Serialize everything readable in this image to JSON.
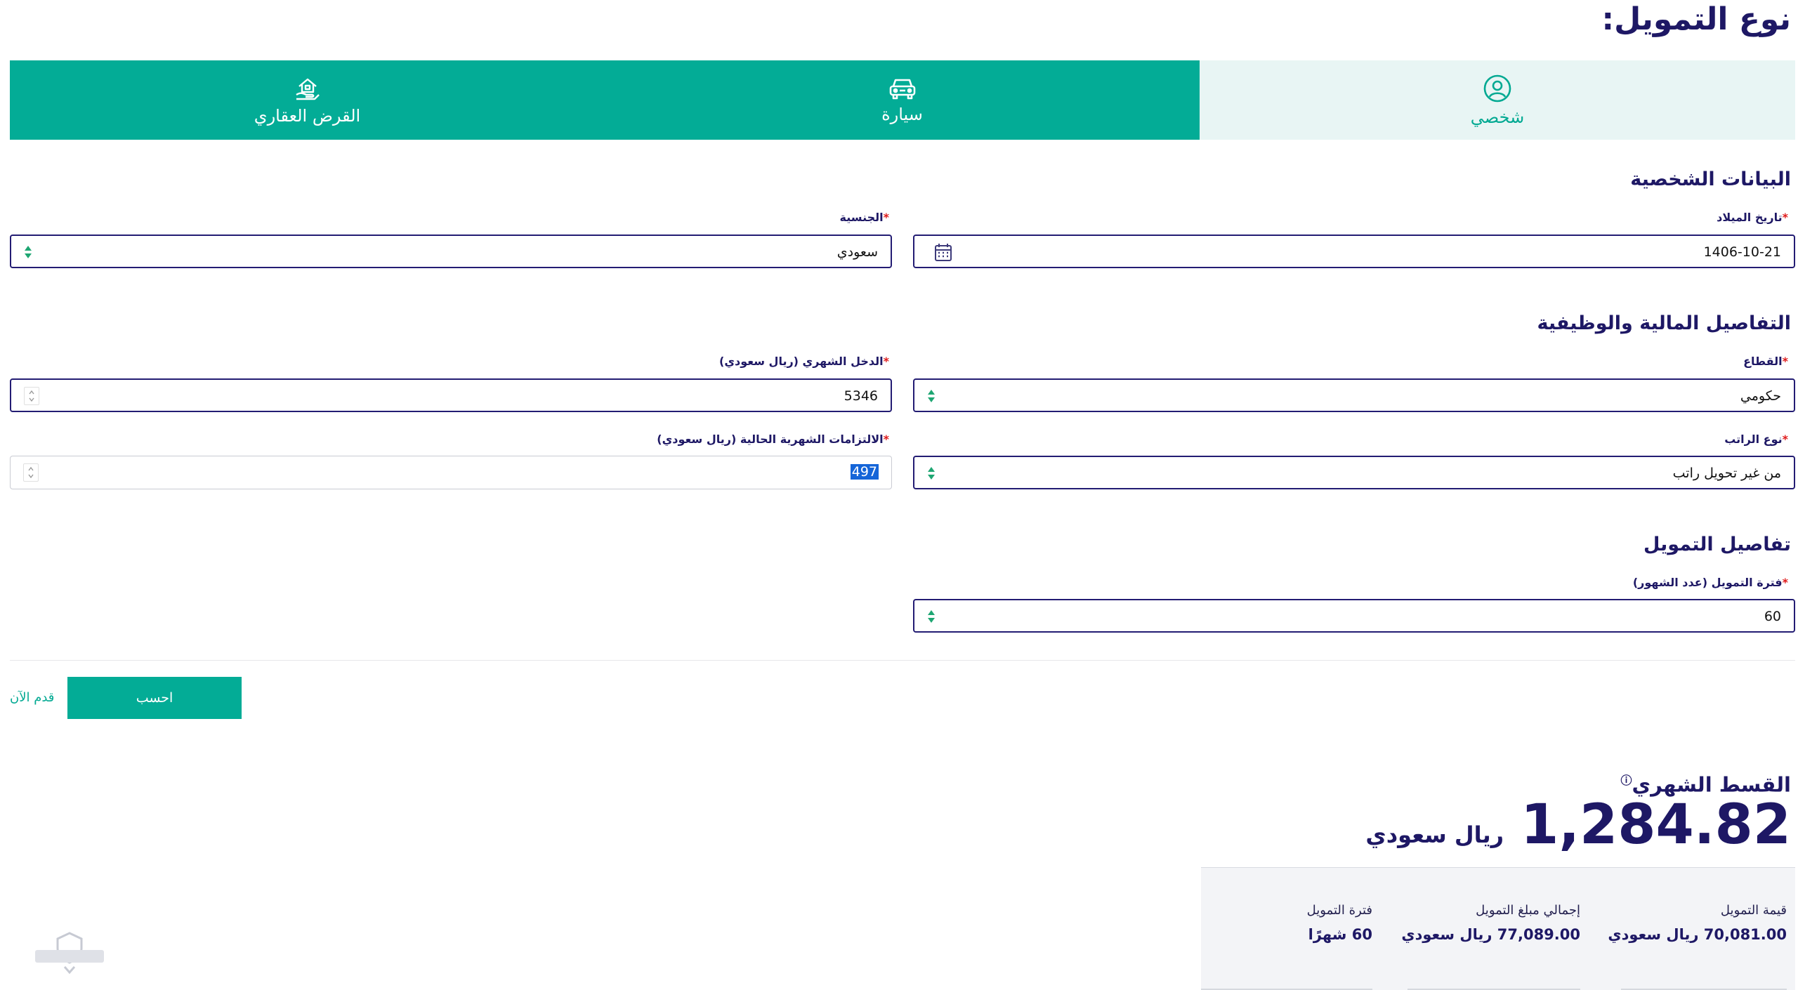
{
  "page_title": "نوع التمويل:",
  "tabs": [
    {
      "label": "القرض العقاري",
      "icon": "house-hand-icon",
      "active": false
    },
    {
      "label": "سيارة",
      "icon": "car-icon",
      "active": false
    },
    {
      "label": "شخصي",
      "icon": "user-circle-icon",
      "active": true
    }
  ],
  "sections": {
    "personal": "البيانات الشخصية",
    "financial": "التفاصيل المالية والوظيفية",
    "financing": "تفاصيل التمويل"
  },
  "fields": {
    "birth_date": {
      "label": "تاريخ الميلاد",
      "value": "1406-10-21"
    },
    "nationality": {
      "label": "الجنسية",
      "value": "سعودي"
    },
    "sector": {
      "label": "القطاع",
      "value": "حكومي"
    },
    "monthly_income": {
      "label": "الدخل الشهري (ريال سعودي)",
      "value": "5346"
    },
    "salary_type": {
      "label": "نوع الراتب",
      "value": "من غير تحويل راتب"
    },
    "obligations": {
      "label": "الالتزامات الشهرية الحالية (ريال سعودي)",
      "value": "497"
    },
    "period": {
      "label": "فترة التمويل (عدد الشهور)",
      "value": "60"
    }
  },
  "required_mark": "*",
  "actions": {
    "calculate": "احسب",
    "apply_now": "قدم الآن"
  },
  "result": {
    "title": "القسط الشهري",
    "info_icon": "ⓘ",
    "amount": "1,284.82",
    "currency": "ريال سعودي"
  },
  "summary": [
    {
      "label": "قيمة التمويل",
      "value": "70,081.00 ريال سعودي"
    },
    {
      "label": "إجمالي مبلغ التمويل",
      "value": "77,089.00 ريال سعودي"
    },
    {
      "label": "فترة التمويل",
      "value": "60 شهرًا"
    }
  ],
  "colors": {
    "brand_teal": "#03ac96",
    "navy": "#1e1865",
    "required": "#e01b1b"
  }
}
